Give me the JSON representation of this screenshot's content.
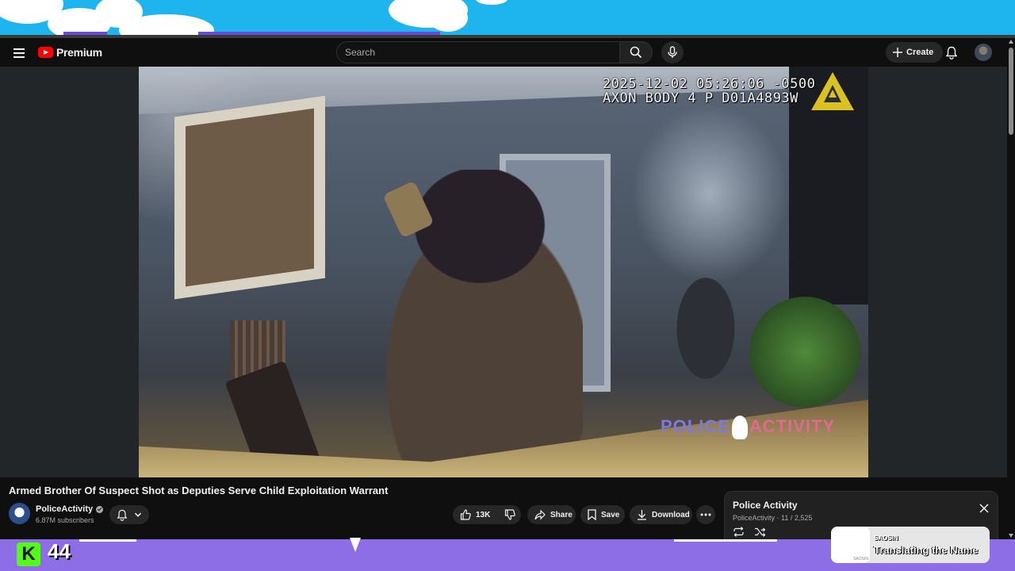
{
  "masthead": {
    "logo_text": "Premium",
    "search_placeholder": "Search",
    "create_label": "Create"
  },
  "video": {
    "timestamp": "2025-12-02 05:26:06 -0500",
    "device": "AXON BODY 4 P D01A4893W",
    "watermark_left": "POLICE",
    "watermark_right": "ACTIVITY",
    "title": "Armed Brother Of Suspect Shot as Deputies Serve Child Exploitation Warrant"
  },
  "channel": {
    "name": "PoliceActivity",
    "subscribers": "6.87M subscribers"
  },
  "actions": {
    "likes": "13K",
    "share": "Share",
    "save": "Save",
    "download": "Download"
  },
  "playlist": {
    "title": "Police Activity",
    "subtitle": "PoliceActivity · 11 / 2,525"
  },
  "stream_overlay": {
    "viewer_count": "44",
    "k_logo": "K",
    "now_playing_artist": "SAOSIN",
    "now_playing_song": "Translating the Name",
    "album_art_caption": "SAOSIN"
  },
  "colors": {
    "youtube_red": "#ff0000",
    "top_band": "#1eb4ee",
    "bottom_band": "#8e6ee6",
    "kick_green": "#53fc18"
  },
  "icons": [
    "menu-icon",
    "youtube-logo-icon",
    "search-icon",
    "mic-icon",
    "plus-icon",
    "bell-icon",
    "verified-icon",
    "chevron-down-icon",
    "thumbs-up-icon",
    "thumbs-down-icon",
    "share-icon",
    "bookmark-icon",
    "download-icon",
    "more-icon",
    "close-icon",
    "loop-icon",
    "shuffle-icon"
  ]
}
